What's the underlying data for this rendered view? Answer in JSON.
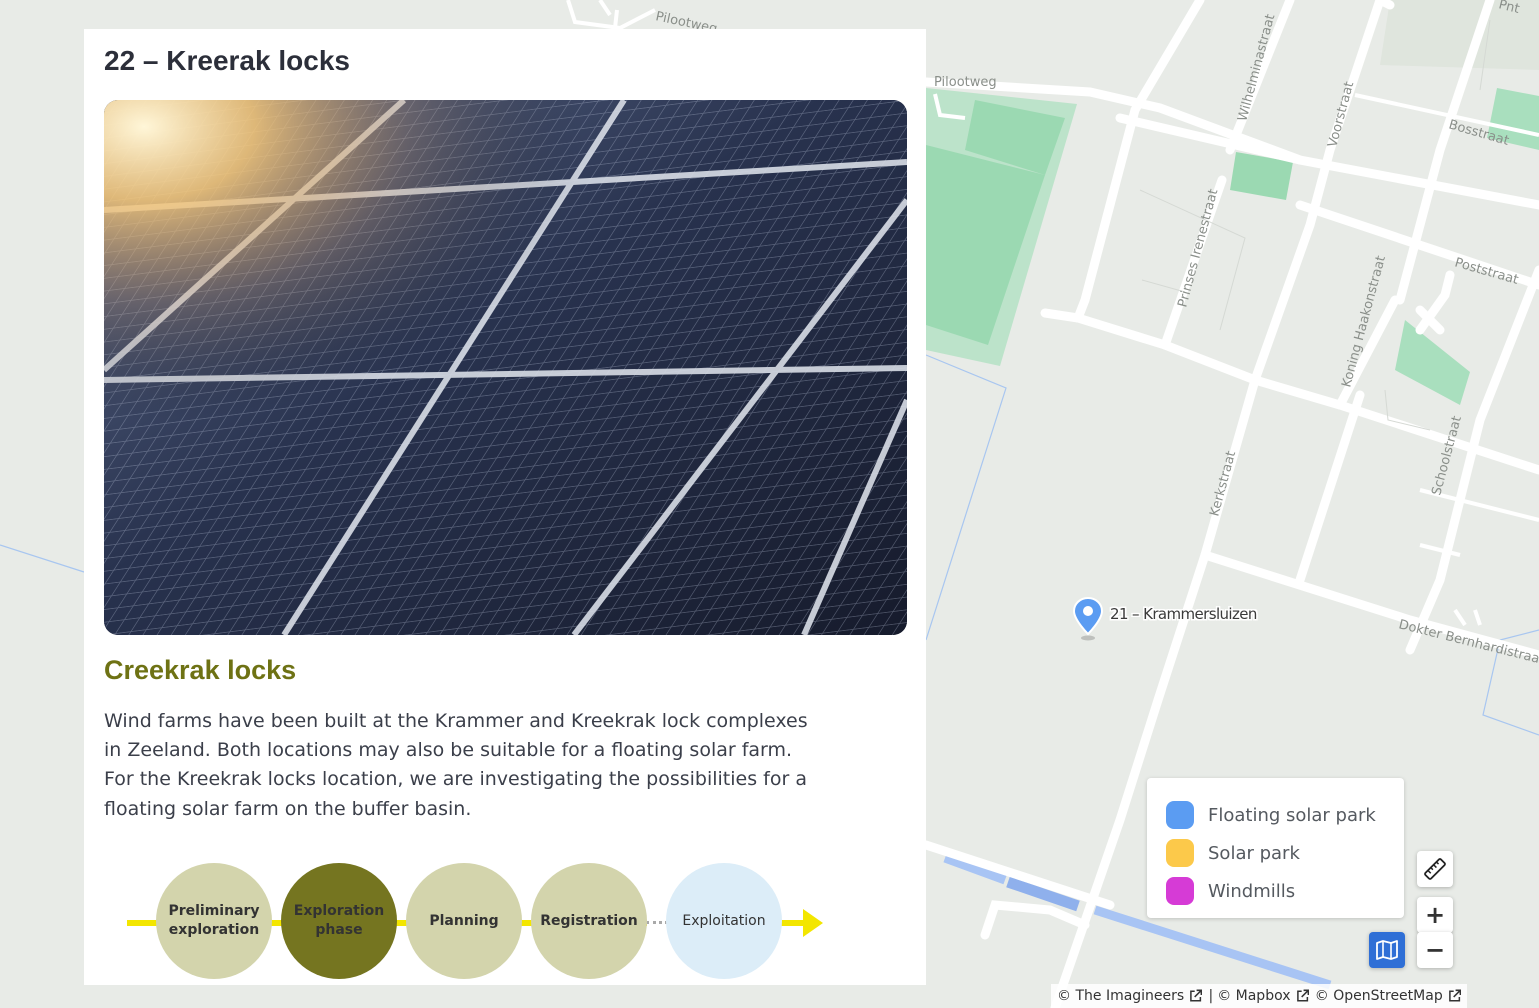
{
  "panel": {
    "title": "22 – Kreerak locks",
    "subtitle": "Creekrak locks",
    "description": "Wind farms have been built at the Krammer and Kreekrak lock complexes in Zeeland. Both locations may also be suitable for a floating solar farm. For the Kreekrak locks location, we are investigating the possibilities for a floating solar farm on the buffer basin.",
    "hero_image": "solar-panels-photo",
    "timeline": {
      "stages": [
        {
          "label": "Preliminary exploration",
          "state": "done"
        },
        {
          "label": "Exploration phase",
          "state": "current"
        },
        {
          "label": "Planning",
          "state": "done"
        },
        {
          "label": "Registration",
          "state": "done"
        },
        {
          "label": "Exploitation",
          "state": "future"
        }
      ]
    }
  },
  "map": {
    "streets": [
      "Pilootweg",
      "Pilootweg",
      "Wilhelminastraat",
      "Voorstraat",
      "Bosstraat",
      "Poststraat",
      "Prinses Irenestraat",
      "Koning Haakonstraat",
      "Schoolstraat",
      "Kerkstraat",
      "Dokter Bernhardistraat",
      "Pnt"
    ],
    "marker": {
      "label": "21 – Krammersluizen",
      "icon": "map-pin-icon",
      "color": "#5b9cf2"
    }
  },
  "legend": {
    "items": [
      {
        "label": "Floating solar park",
        "color": "#5b9cf2"
      },
      {
        "label": "Solar park",
        "color": "#fcc94a"
      },
      {
        "label": "Windmills",
        "color": "#d63bd6"
      }
    ]
  },
  "controls": {
    "measure": "ruler-icon",
    "zoom_in": "+",
    "zoom_out": "−",
    "layers": "map-layers-icon"
  },
  "attribution": {
    "items": [
      "© The Imagineers",
      "© Mapbox",
      "© OpenStreetMap"
    ],
    "separator": "|"
  }
}
